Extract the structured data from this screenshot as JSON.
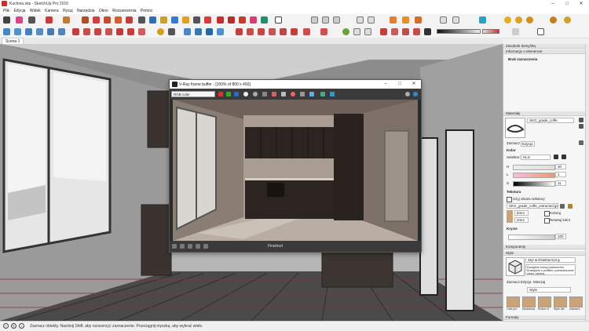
{
  "window": {
    "title": "Kuchnia.skp - SketchUp Pro 2016"
  },
  "menu": [
    "Plik",
    "Edycja",
    "Widok",
    "Kamera",
    "Rysuj",
    "Narzędzia",
    "Okno",
    "Rozszerzenia",
    "Pomoc"
  ],
  "scene_tab": "Scena 1",
  "status_text": "Zaznacz obiekty. Naciśnij Shift, aby rozszerzyć zaznaczenie. Przeciągnij myszką, aby wybrać wiele.",
  "frame_buffer": {
    "title": "V-Ray frame buffer - [100% of 800 x 450]",
    "channel": "RGB color",
    "status": "Finished"
  },
  "panel": {
    "default_tray": "Zasobnik domyślny",
    "entity_info": "Informacje o elemencie",
    "no_selection": "Brak zaznaczenia",
    "materials": {
      "header": "Materiały",
      "material_name": "SKG_grade_coffe",
      "tabs": [
        "Zaznacz",
        "Edycja"
      ],
      "color_label": "Kolor",
      "picker_label": "Selektor:",
      "picker_value": "HLS",
      "h_label": "H",
      "h_value": "30",
      "l_label": "L",
      "l_value": "1",
      "s_label": "S",
      "s_value": "11",
      "texture_label": "Tekstura",
      "use_texture_label": "Użyj obrazu tekstury",
      "texture_file": "SKG_grade_coffe_extracted.jpg",
      "width_value": "5mm",
      "height_value": "2mm",
      "colorize_label": "Koloruj",
      "reset_label": "Resetuj kolor",
      "opacity_label": "Krycie",
      "opacity_value": "100"
    },
    "components": {
      "header": "Komponenty"
    },
    "styles": {
      "header": "Style",
      "style_name": "Styl architektoniczny",
      "style_desc": "Domyślne kolory powierzchni. Krawędzie z profilem, pomarańczowe niebo i ziemia.",
      "tabs": [
        "Zaznacz",
        "Edycja",
        "Mieszaj"
      ],
      "dropdown": "Style",
      "thumbs": [
        "Linie pro",
        "Modelowa",
        "Różne st",
        "Style der",
        "Zaleceni"
      ]
    },
    "shadows_label": "Formaty"
  },
  "colors": {
    "accent": "#c8302c",
    "vray_dark": "#2b2b2b"
  }
}
